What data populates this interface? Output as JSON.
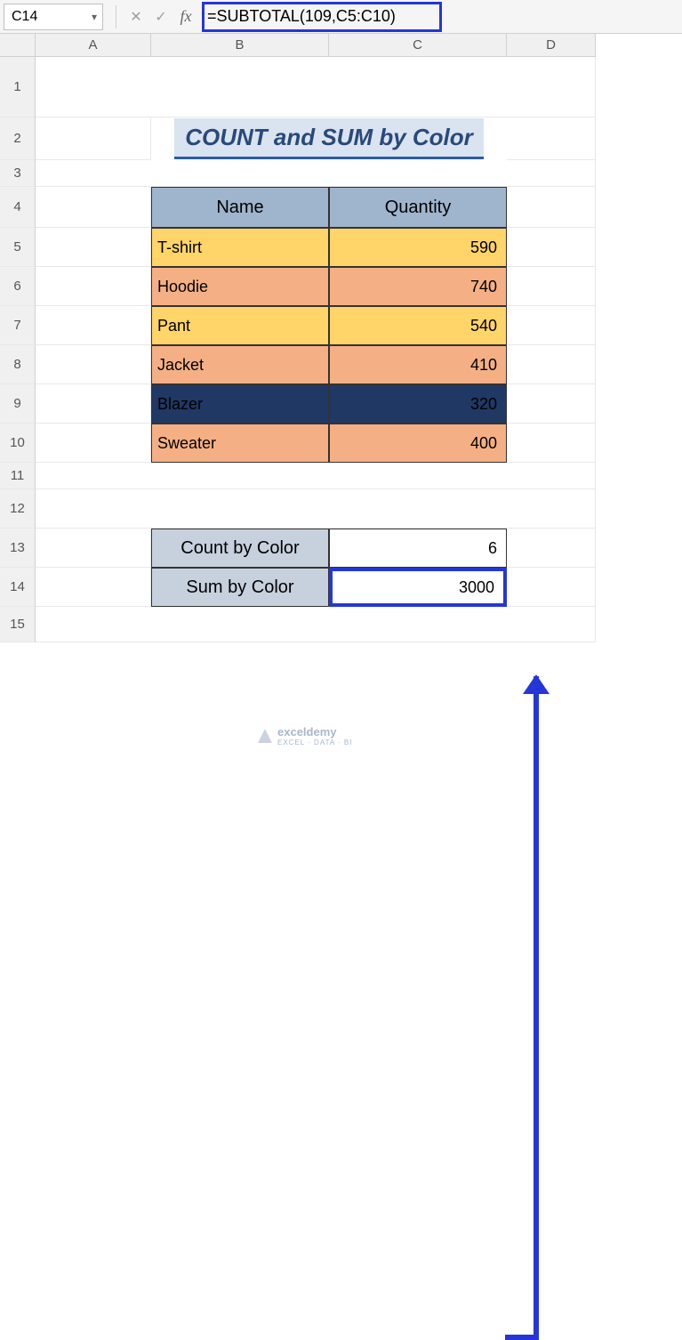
{
  "nameBox": "C14",
  "formula": "=SUBTOTAL(109,C5:C10)",
  "columns": [
    "A",
    "B",
    "C",
    "D"
  ],
  "rows": [
    "1",
    "2",
    "3",
    "4",
    "5",
    "6",
    "7",
    "8",
    "9",
    "10",
    "11",
    "12",
    "13",
    "14",
    "15"
  ],
  "title": "COUNT and SUM by Color",
  "headers": {
    "name": "Name",
    "qty": "Quantity"
  },
  "items": [
    {
      "name": "T-shirt",
      "qty": "590",
      "cls": "yellow"
    },
    {
      "name": "Hoodie",
      "qty": "740",
      "cls": "orange"
    },
    {
      "name": "Pant",
      "qty": "540",
      "cls": "yellow"
    },
    {
      "name": "Jacket",
      "qty": "410",
      "cls": "orange"
    },
    {
      "name": "Blazer",
      "qty": "320",
      "cls": "navy"
    },
    {
      "name": "Sweater",
      "qty": "400",
      "cls": "orange"
    }
  ],
  "labels": {
    "count": "Count by Color",
    "sum": "Sum by Color"
  },
  "results": {
    "count": "6",
    "sum": "3000"
  },
  "watermark": "exceldemy",
  "watermark_sub": "EXCEL · DATA · BI",
  "chart_data": {
    "type": "table",
    "title": "COUNT and SUM by Color",
    "columns": [
      "Name",
      "Quantity"
    ],
    "rows": [
      [
        "T-shirt",
        590
      ],
      [
        "Hoodie",
        740
      ],
      [
        "Pant",
        540
      ],
      [
        "Jacket",
        410
      ],
      [
        "Blazer",
        320
      ],
      [
        "Sweater",
        400
      ]
    ],
    "summary": {
      "Count by Color": 6,
      "Sum by Color": 3000
    }
  }
}
